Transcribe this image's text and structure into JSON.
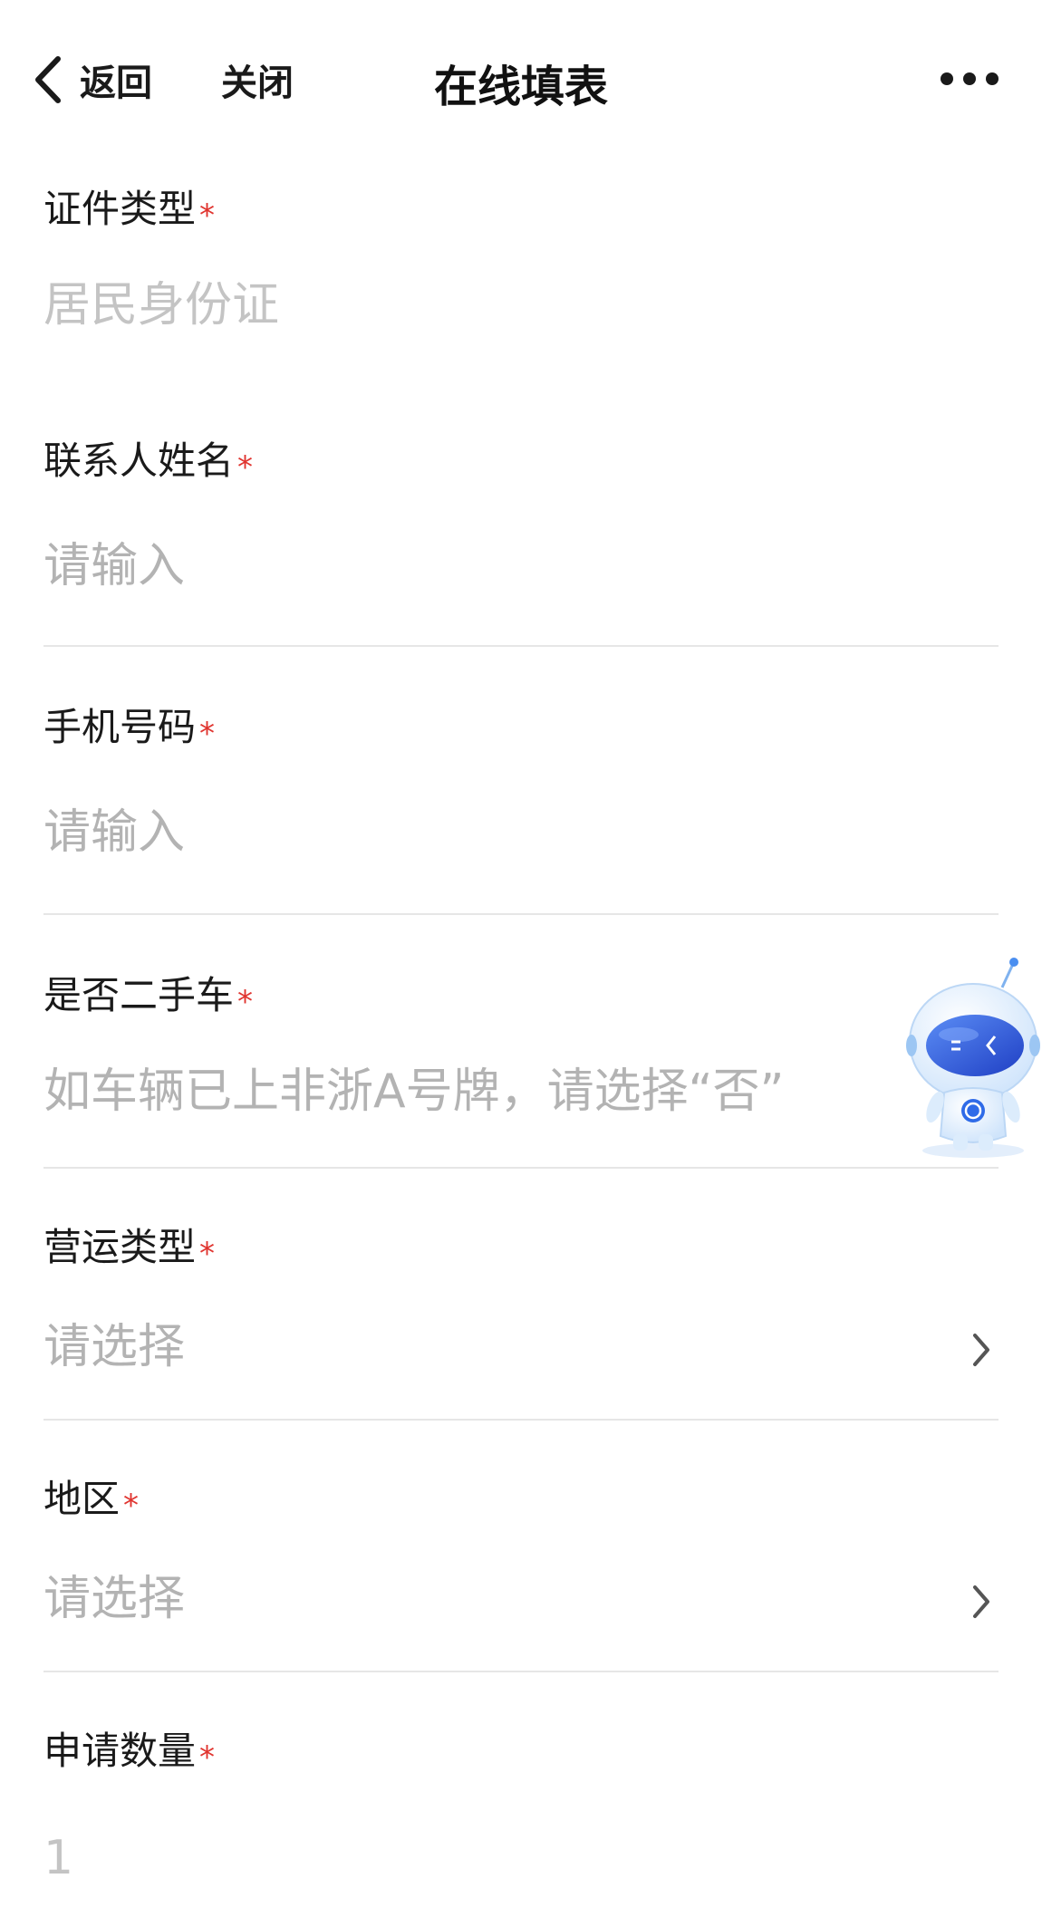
{
  "header": {
    "back_label": "返回",
    "close_label": "关闭",
    "title": "在线填表"
  },
  "fields": {
    "id_type": {
      "label": "证件类型",
      "required_mark": "*",
      "value": "居民身份证"
    },
    "contact_name": {
      "label": "联系人姓名",
      "required_mark": "*",
      "placeholder": "请输入"
    },
    "phone": {
      "label": "手机号码",
      "required_mark": "*",
      "placeholder": "请输入"
    },
    "second_hand": {
      "label": "是否二手车",
      "required_mark": "*",
      "placeholder": "如车辆已上非浙A号牌，请选择“否”"
    },
    "operation_type": {
      "label": "营运类型",
      "required_mark": "*",
      "placeholder": "请选择"
    },
    "region": {
      "label": "地区",
      "required_mark": "*",
      "placeholder": "请选择"
    },
    "quantity": {
      "label": "申请数量",
      "required_mark": "*",
      "value": "1"
    }
  },
  "icons": {
    "back": "chevron-left-icon",
    "more": "more-dots-icon",
    "select_arrow": "chevron-right-icon",
    "assistant": "robot-assistant-icon"
  },
  "colors": {
    "required": "#e0342f",
    "placeholder": "#b3b3b3",
    "divider": "#e6e6e6",
    "robot_blue": "#2f6be8"
  }
}
